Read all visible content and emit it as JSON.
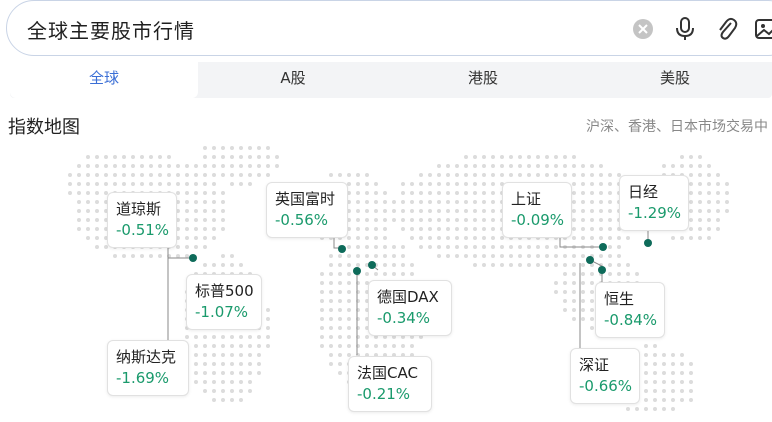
{
  "search": {
    "query": "全球主要股市行情"
  },
  "icons": {
    "clear": "clear-icon",
    "mic": "microphone-icon",
    "attach": "paperclip-icon",
    "image": "image-icon"
  },
  "tabs": [
    {
      "label": "全球",
      "active": true
    },
    {
      "label": "A股",
      "active": false
    },
    {
      "label": "港股",
      "active": false
    },
    {
      "label": "美股",
      "active": false
    }
  ],
  "section": {
    "title": "指数地图",
    "note": "沪深、香港、日本市场交易中"
  },
  "colors": {
    "down": "#1a9a6c",
    "marker": "#0e6b5a",
    "active_tab": "#3b6fd6"
  },
  "indices": [
    {
      "name": "道琼斯",
      "change": "-0.51%"
    },
    {
      "name": "标普500",
      "change": "-1.07%"
    },
    {
      "name": "纳斯达克",
      "change": "-1.69%"
    },
    {
      "name": "英国富时",
      "change": "-0.56%"
    },
    {
      "name": "德国DAX",
      "change": "-0.34%"
    },
    {
      "name": "法国CAC",
      "change": "-0.21%"
    },
    {
      "name": "上证",
      "change": "-0.09%"
    },
    {
      "name": "日经",
      "change": "-1.29%"
    },
    {
      "name": "恒生",
      "change": "-0.84%"
    },
    {
      "name": "深证",
      "change": "-0.66%"
    }
  ]
}
